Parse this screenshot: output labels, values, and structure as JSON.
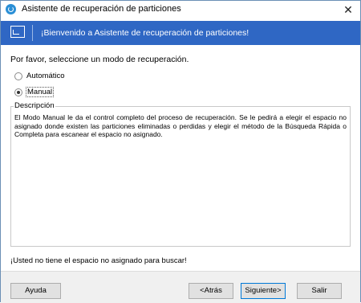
{
  "window": {
    "title": "Asistente de recuperación de particiones",
    "close_glyph": "✕",
    "app_icon": "partition-wizard-icon"
  },
  "banner": {
    "text": "¡Bienvenido a Asistente de recuperación de particiones!",
    "icon": "partition-restore-icon",
    "background": "#2f67c4"
  },
  "main": {
    "prompt": "Por favor, seleccione un modo de recuperación.",
    "options": [
      {
        "label": "Automático",
        "selected": false
      },
      {
        "label": "Manual",
        "selected": true
      }
    ],
    "description": {
      "legend": "Descripción",
      "text": "El Modo Manual le da el control completo del proceso de recuperación. Se le pedirá a elegir el espacio no asignado donde existen las particiones eliminadas o perdidas y elegir el método de la Búsqueda Rápida o Completa para escanear el espacio no asignado."
    },
    "notice": "¡Usted no tiene el espacio no asignado para buscar!"
  },
  "buttons": {
    "help": "Ayuda",
    "back": "<Atrás",
    "next": "Siguiente>",
    "exit": "Salir"
  }
}
